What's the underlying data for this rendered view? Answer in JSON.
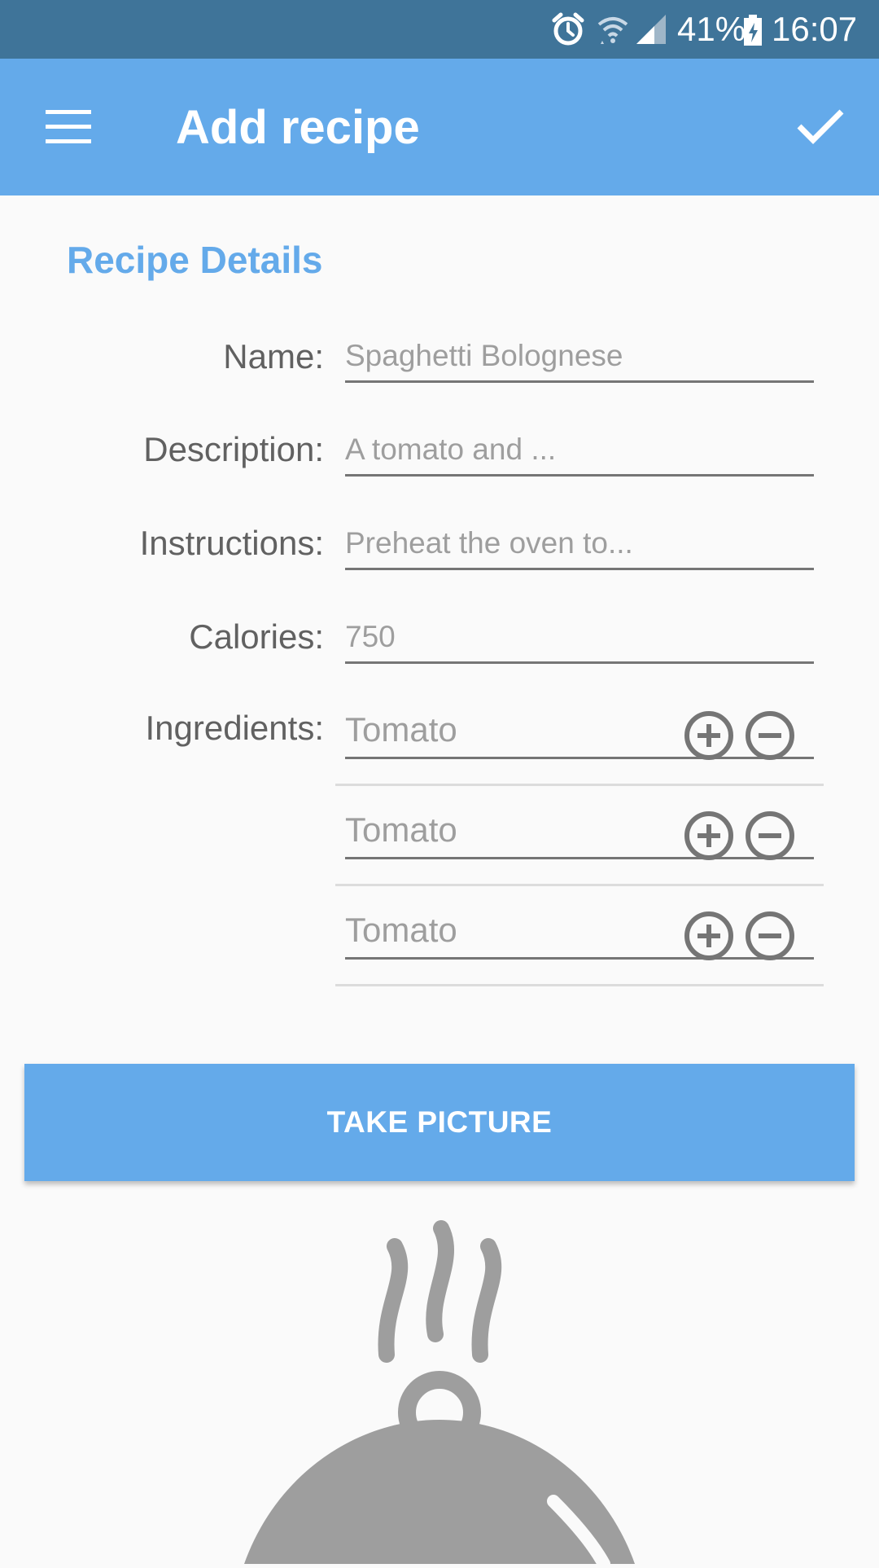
{
  "status_bar": {
    "battery": "41%",
    "time": "16:07",
    "icons": [
      "alarm-icon",
      "wifi-icon",
      "signal-icon",
      "battery-icon"
    ]
  },
  "app_bar": {
    "title": "Add recipe",
    "menu_icon": "menu-icon",
    "save_icon": "check-icon"
  },
  "form": {
    "section_title": "Recipe Details",
    "fields": [
      {
        "label": "Name:",
        "placeholder": "Spaghetti Bolognese"
      },
      {
        "label": "Description:",
        "placeholder": "A tomato and ..."
      },
      {
        "label": "Instructions:",
        "placeholder": "Preheat the oven to..."
      },
      {
        "label": "Calories:",
        "placeholder": "750"
      }
    ],
    "ingredients_label": "Ingredients:",
    "ingredients": [
      {
        "placeholder": "Tomato"
      },
      {
        "placeholder": "Tomato"
      },
      {
        "placeholder": "Tomato"
      }
    ]
  },
  "take_picture": {
    "label": "TAKE PICTURE"
  },
  "colors": {
    "status_bar": "#3f7499",
    "primary": "#64aaea",
    "icon_gray": "#757575",
    "placeholder": "#9e9e9e"
  }
}
